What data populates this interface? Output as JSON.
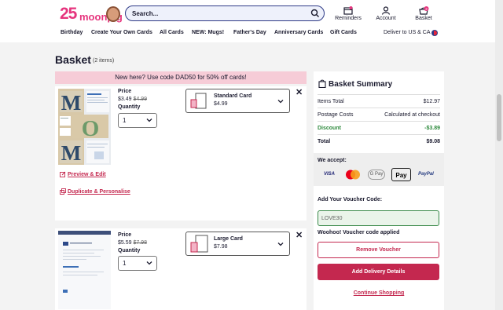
{
  "header": {
    "logo_number": "25",
    "logo_text": "moonpig",
    "search_placeholder": "Search...",
    "reminders_label": "Reminders",
    "account_label": "Account",
    "basket_label": "Basket",
    "basket_count": "2"
  },
  "nav": {
    "items": [
      "Birthday",
      "Create Your Own Cards",
      "All Cards",
      "NEW: Mugs!",
      "Father's Day",
      "Anniversary Cards",
      "Gift Cards"
    ],
    "deliver_label": "Deliver to US & CA"
  },
  "basket": {
    "title": "Basket",
    "count": "(2 items)",
    "banner": "New here? Use code DAD50 for 50% off cards!",
    "items": [
      {
        "price_label": "Price",
        "price": "$3.49",
        "old_price": "$4.99",
        "quantity_label": "Quantity",
        "quantity": "1",
        "size_name": "Standard Card",
        "size_price": "$4.99",
        "preview_link": "Preview & Edit",
        "duplicate_link": "Duplicate & Personalise",
        "letters": [
          "M",
          "O",
          "M"
        ]
      },
      {
        "price_label": "Price",
        "price": "$5.59",
        "old_price": "$7.98",
        "quantity_label": "Quantity",
        "quantity": "1",
        "size_name": "Large Card",
        "size_price": "$7.98"
      }
    ]
  },
  "summary": {
    "title": "Basket Summary",
    "rows": [
      {
        "label": "Items Total",
        "value": "$12.97"
      },
      {
        "label": "Postage Costs",
        "value": "Calculated at checkout"
      },
      {
        "label": "Discount",
        "value": "-$3.89"
      },
      {
        "label": "Total",
        "value": "$9.08"
      }
    ],
    "accept_label": "We accept:",
    "payment_methods": [
      "VISA",
      "Mastercard",
      "G Pay",
      "Apple Pay",
      "PayPal"
    ],
    "payment_labels": {
      "visa": "VISA",
      "gpay": "G Pay",
      "applepay": "Pay",
      "paypal": "PayPal"
    },
    "voucher_label": "Add Your Voucher Code:",
    "voucher_value": "LOVE30",
    "voucher_success": "Woohoo! Voucher code applied",
    "remove_voucher": "Remove Voucher",
    "add_delivery": "Add Delivery Details",
    "continue_shopping": "Continue Shopping"
  },
  "colors": {
    "brand_pink": "#e6357e",
    "accent_red": "#c4284f",
    "navy": "#2e3a86",
    "banner_bg": "#f6ccd7",
    "success_green": "#2e8a3d"
  }
}
